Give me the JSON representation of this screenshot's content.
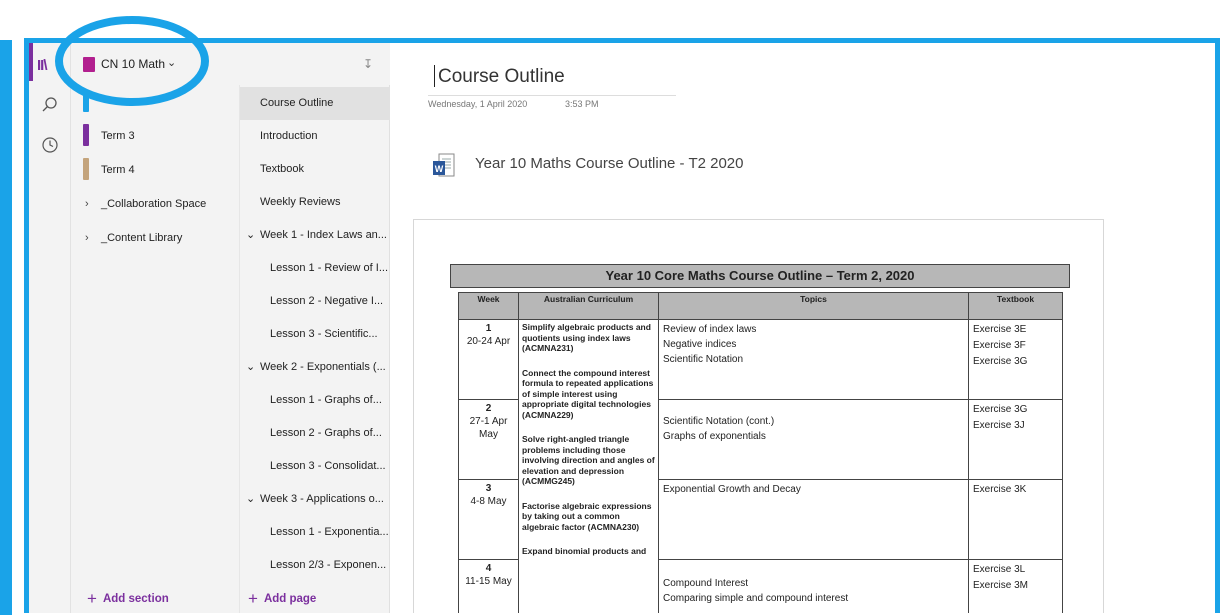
{
  "notebook": {
    "name": "CN 10 Math"
  },
  "sections": [
    {
      "label": "",
      "color": "#1aa3e8"
    },
    {
      "label": "Term 3",
      "color": "#7b2f9e"
    },
    {
      "label": "Term 4",
      "color": "#c4a47c"
    },
    {
      "label": "_Collaboration Space",
      "group": true
    },
    {
      "label": "_Content Library",
      "group": true
    }
  ],
  "pages": [
    {
      "label": "Course Outline",
      "selected": true
    },
    {
      "label": "Introduction"
    },
    {
      "label": "Textbook"
    },
    {
      "label": "Weekly Reviews"
    },
    {
      "label": "Week 1 - Index Laws an...",
      "group": true
    },
    {
      "label": "Lesson 1 - Review of I..."
    },
    {
      "label": "Lesson 2 - Negative I..."
    },
    {
      "label": "Lesson 3 - Scientific..."
    },
    {
      "label": "Week 2 - Exponentials (...",
      "group": true
    },
    {
      "label": "Lesson 1 - Graphs of..."
    },
    {
      "label": "Lesson 2 - Graphs of..."
    },
    {
      "label": "Lesson 3 - Consolidat..."
    },
    {
      "label": "Week 3 - Applications o...",
      "group": true
    },
    {
      "label": "Lesson 1 - Exponentia..."
    },
    {
      "label": "Lesson 2/3 - Exponen..."
    }
  ],
  "add_section": "Add section",
  "add_page": "Add page",
  "page": {
    "title": "Course Outline",
    "date": "Wednesday, 1 April 2020",
    "time": "3:53 PM",
    "attachment": "Year 10 Maths Course Outline - T2 2020"
  },
  "doc": {
    "heading": "Year 10 Core Maths Course Outline – Term 2, 2020",
    "headers": {
      "week": "Week",
      "curriculum": "Australian Curriculum",
      "topics": "Topics",
      "textbook": "Textbook"
    },
    "curriculum_text": [
      "Simplify algebraic products and quotients using index laws (ACMNA231)",
      "Connect the compound interest formula to repeated applications of simple interest using appropriate digital technologies (ACMNA229)",
      "Solve right-angled triangle problems including those involving direction and angles of elevation and depression (ACMMG245)",
      "Factorise algebraic expressions by taking out a common algebraic factor (ACMNA230)",
      "Expand binomial products and"
    ],
    "rows": [
      {
        "week": "1",
        "dates": "20-24 Apr",
        "topics": [
          "Review of index laws",
          "Negative indices",
          "Scientific Notation"
        ],
        "textbook": [
          "Exercise 3E",
          "Exercise 3F",
          "Exercise 3G"
        ]
      },
      {
        "week": "2",
        "dates": "27-1 Apr May",
        "topics": [
          "Scientific Notation (cont.)",
          "Graphs of exponentials"
        ],
        "textbook": [
          "Exercise 3G",
          "Exercise 3J"
        ]
      },
      {
        "week": "3",
        "dates": "4-8 May",
        "topics": [
          "Exponential Growth and Decay"
        ],
        "textbook": [
          "Exercise 3K"
        ]
      },
      {
        "week": "4",
        "dates": "11-15 May",
        "topics": [
          "Compound Interest",
          "Comparing simple and compound interest"
        ],
        "textbook": [
          "Exercise 3L",
          "Exercise 3M"
        ]
      }
    ]
  },
  "colors": {
    "accent": "#1aa3e8",
    "onenote_purple": "#7b2f9e"
  },
  "icons": [
    "search-icon",
    "recent-icon",
    "sort-icon",
    "word-doc-icon",
    "chevron-down-icon"
  ]
}
